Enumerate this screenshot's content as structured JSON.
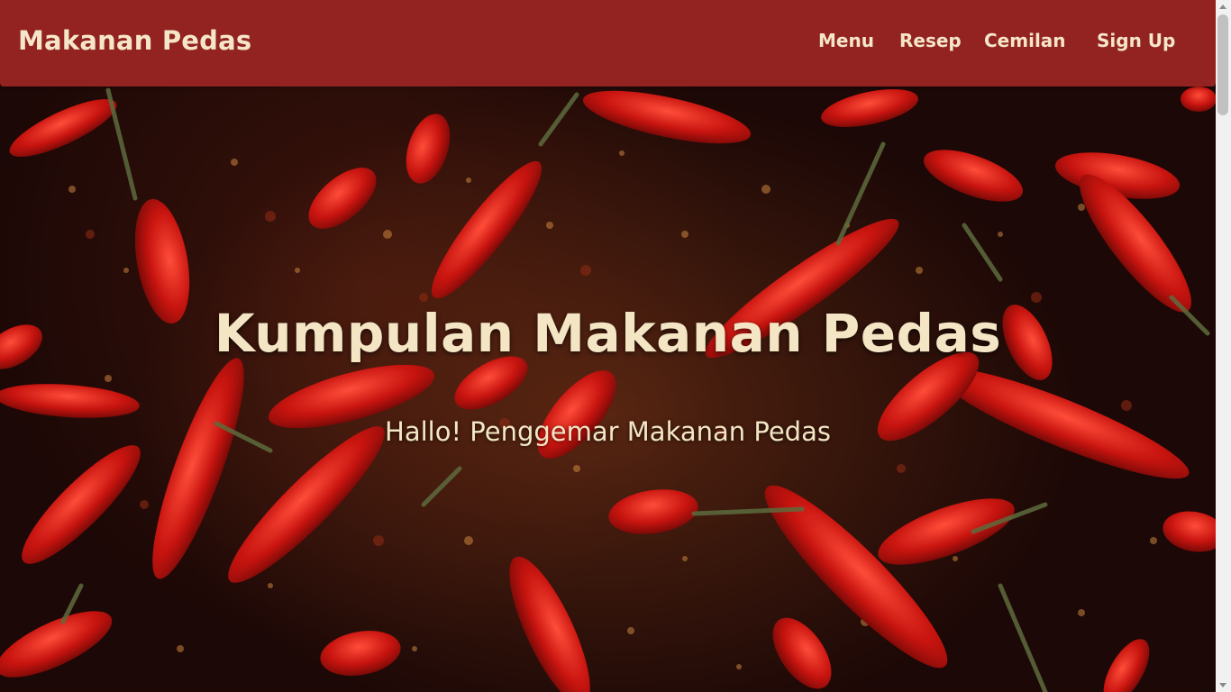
{
  "header": {
    "brand": "Makanan Pedas",
    "nav": [
      {
        "label": "Menu"
      },
      {
        "label": "Resep"
      },
      {
        "label": "Cemilan"
      },
      {
        "label": "Sign Up"
      }
    ]
  },
  "hero": {
    "title": "Kumpulan Makanan Pedas",
    "subtitle": "Hallo! Penggemar Makanan Pedas",
    "image": "red-chili-peppers-background"
  },
  "colors": {
    "navbar": "#922321",
    "text": "#F6E6C9",
    "chili": "#C8140F"
  }
}
